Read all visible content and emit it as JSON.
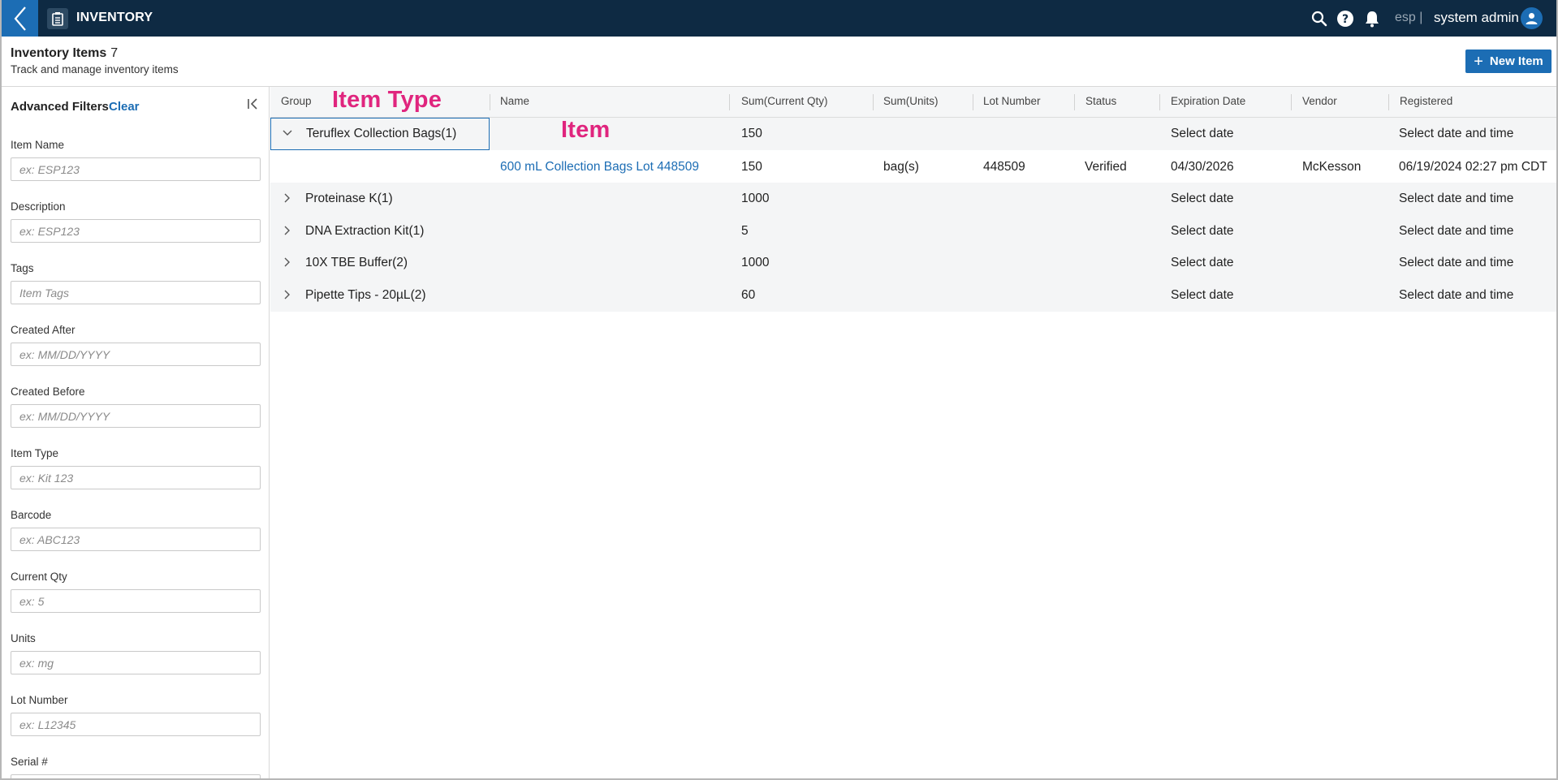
{
  "app": {
    "title": "INVENTORY",
    "tenant": "esp |",
    "user": "system admin"
  },
  "header": {
    "title": "Inventory Items",
    "count": "7",
    "subtitle": "Track and manage inventory items",
    "new_button": "New Item"
  },
  "sidebar": {
    "heading": "Advanced Filters",
    "clear": "Clear",
    "filters": [
      {
        "label": "Item Name",
        "placeholder": "ex: ESP123"
      },
      {
        "label": "Description",
        "placeholder": "ex: ESP123"
      },
      {
        "label": "Tags",
        "placeholder": "Item Tags"
      },
      {
        "label": "Created After",
        "placeholder": "ex: MM/DD/YYYY"
      },
      {
        "label": "Created Before",
        "placeholder": "ex: MM/DD/YYYY"
      },
      {
        "label": "Item Type",
        "placeholder": "ex: Kit 123"
      },
      {
        "label": "Barcode",
        "placeholder": "ex: ABC123"
      },
      {
        "label": "Current Qty",
        "placeholder": "ex: 5"
      },
      {
        "label": "Units",
        "placeholder": "ex: mg"
      },
      {
        "label": "Lot Number",
        "placeholder": "ex: L12345"
      },
      {
        "label": "Serial #",
        "placeholder": ""
      }
    ]
  },
  "table": {
    "columns": [
      "Group",
      "Name",
      "Sum(Current Qty)",
      "Sum(Units)",
      "Lot Number",
      "Status",
      "Expiration Date",
      "Vendor",
      "Registered"
    ],
    "annotations": {
      "item_type": "Item Type",
      "item": "Item"
    },
    "rows": [
      {
        "kind": "group",
        "expanded": true,
        "group": "Teruflex Collection Bags",
        "count": "(1)",
        "qty": "150",
        "expiration": "Select date",
        "registered": "Select date and time"
      },
      {
        "kind": "item",
        "name": "600 mL Collection Bags Lot 448509",
        "qty": "150",
        "units": "bag(s)",
        "lot": "448509",
        "status": "Verified",
        "expiration": "04/30/2026",
        "vendor": "McKesson",
        "registered": "06/19/2024 02:27 pm CDT"
      },
      {
        "kind": "group",
        "expanded": false,
        "group": "Proteinase K",
        "count": "(1)",
        "qty": "1000",
        "expiration": "Select date",
        "registered": "Select date and time"
      },
      {
        "kind": "group",
        "expanded": false,
        "group": "DNA Extraction Kit",
        "count": "(1)",
        "qty": "5",
        "expiration": "Select date",
        "registered": "Select date and time"
      },
      {
        "kind": "group",
        "expanded": false,
        "group": "10X TBE Buffer",
        "count": "(2)",
        "qty": "1000",
        "expiration": "Select date",
        "registered": "Select date and time"
      },
      {
        "kind": "group",
        "expanded": false,
        "group": "Pipette Tips - 20µL",
        "count": "(2)",
        "qty": "60",
        "expiration": "Select date",
        "registered": "Select date and time"
      }
    ]
  },
  "icons": {
    "back": "chevron-left-icon",
    "app": "clipboard-icon",
    "search": "search-icon",
    "help": "help-icon",
    "notifications": "bell-icon",
    "avatar": "user-icon",
    "new": "plus-icon",
    "collapse": "collapse-left-icon",
    "expand": "chevron-right-icon",
    "collapse_group": "chevron-down-icon"
  },
  "colors": {
    "topbar": "#0e2a43",
    "accent": "#1c6db4",
    "annotation": "#e0257e"
  }
}
